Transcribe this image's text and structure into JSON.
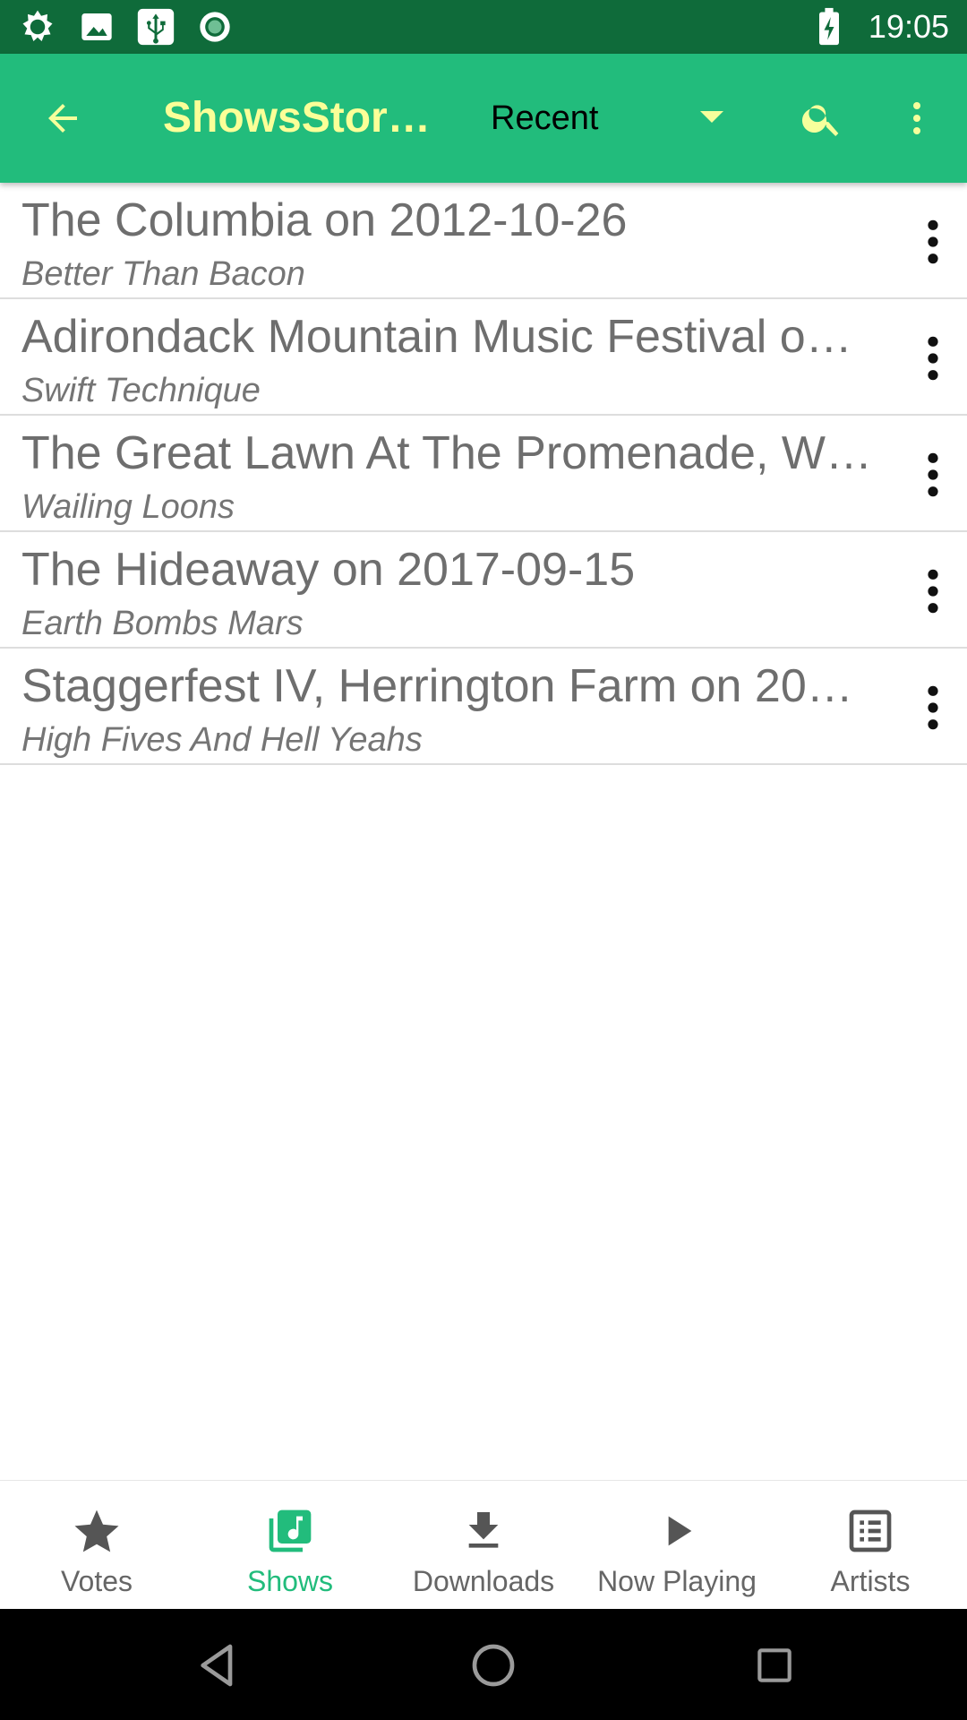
{
  "status_bar": {
    "time": "19:05",
    "icons": [
      "brightness-icon",
      "image-icon",
      "usb-icon",
      "record-icon",
      "battery-charging-icon"
    ]
  },
  "app_bar": {
    "title": "ShowsStore…",
    "sort_selected": "Recent",
    "colors": {
      "bar": "#22bc7c",
      "title": "#fbff98"
    }
  },
  "shows": [
    {
      "title": "The Columbia on 2012-10-26",
      "artist": "Better Than Bacon"
    },
    {
      "title": "Adirondack Mountain Music Festival o…",
      "artist": "Swift Technique"
    },
    {
      "title": "The Great Lawn At The Promenade, W…",
      "artist": "Wailing Loons"
    },
    {
      "title": "The Hideaway on 2017-09-15",
      "artist": "Earth Bombs Mars"
    },
    {
      "title": "Staggerfest IV, Herrington Farm on 20…",
      "artist": "High Fives And Hell Yeahs"
    }
  ],
  "bottom_nav": {
    "items": [
      {
        "label": "Votes",
        "icon": "star-icon"
      },
      {
        "label": "Shows",
        "icon": "music-library-icon",
        "active": true
      },
      {
        "label": "Downloads",
        "icon": "download-icon"
      },
      {
        "label": "Now Playing",
        "icon": "play-icon"
      },
      {
        "label": "Artists",
        "icon": "list-icon"
      }
    ]
  }
}
